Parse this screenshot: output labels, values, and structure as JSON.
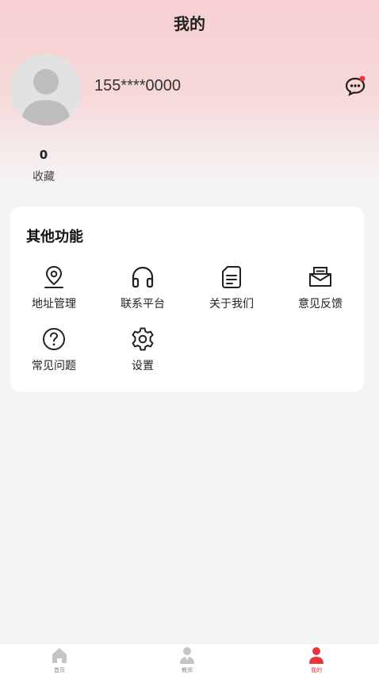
{
  "status_bar": {
    "time_left": "",
    "right": ""
  },
  "header": {
    "title": "我的"
  },
  "profile": {
    "phone": "155****0000",
    "message_icon": "chat-bubble-icon",
    "has_notification": true
  },
  "stats": {
    "favorites_count": "0",
    "favorites_label": "收藏"
  },
  "other_functions": {
    "title": "其他功能",
    "items": [
      {
        "label": "地址管理",
        "icon": "location-pin-icon"
      },
      {
        "label": "联系平台",
        "icon": "headphones-icon"
      },
      {
        "label": "关于我们",
        "icon": "document-icon"
      },
      {
        "label": "意见反馈",
        "icon": "mail-icon"
      },
      {
        "label": "常见问题",
        "icon": "question-icon"
      },
      {
        "label": "设置",
        "icon": "gear-icon"
      }
    ]
  },
  "tabbar": {
    "items": [
      {
        "label": "首页",
        "icon": "home-icon",
        "active": false
      },
      {
        "label": "教师",
        "icon": "teacher-icon",
        "active": false
      },
      {
        "label": "我的",
        "icon": "user-icon",
        "active": true
      }
    ]
  },
  "colors": {
    "accent": "#e8363c",
    "header_pink": "#f6cfd1",
    "background": "#f4f4f4"
  }
}
